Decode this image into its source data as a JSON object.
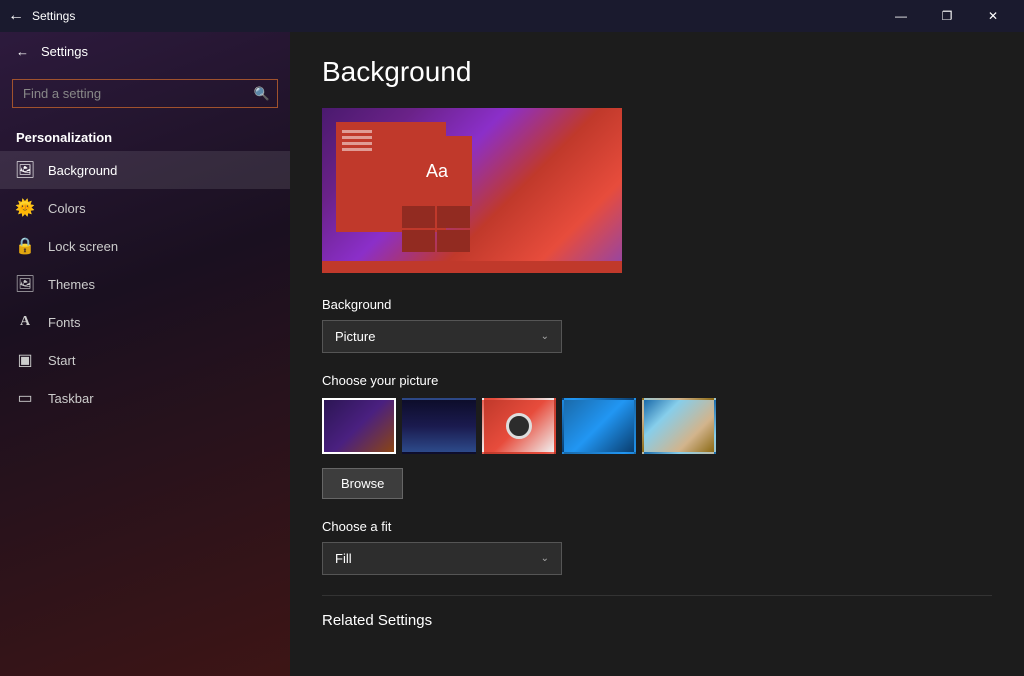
{
  "titlebar": {
    "title": "Settings",
    "back_label": "←",
    "minimize_label": "—",
    "maximize_label": "❐",
    "close_label": "✕"
  },
  "sidebar": {
    "section_title": "Personalization",
    "search_placeholder": "Find a setting",
    "items": [
      {
        "id": "background",
        "label": "Background",
        "icon": "🖼"
      },
      {
        "id": "colors",
        "label": "Colors",
        "icon": "🎨"
      },
      {
        "id": "lock-screen",
        "label": "Lock screen",
        "icon": "🔒"
      },
      {
        "id": "themes",
        "label": "Themes",
        "icon": "🖥"
      },
      {
        "id": "fonts",
        "label": "Fonts",
        "icon": "A"
      },
      {
        "id": "start",
        "label": "Start",
        "icon": "⊞"
      },
      {
        "id": "taskbar",
        "label": "Taskbar",
        "icon": "▬"
      }
    ]
  },
  "content": {
    "page_title": "Background",
    "background_label": "Background",
    "background_dropdown": "Picture",
    "choose_picture_label": "Choose your picture",
    "browse_label": "Browse",
    "choose_fit_label": "Choose a fit",
    "fit_dropdown": "Fill",
    "related_settings_label": "Related Settings"
  }
}
